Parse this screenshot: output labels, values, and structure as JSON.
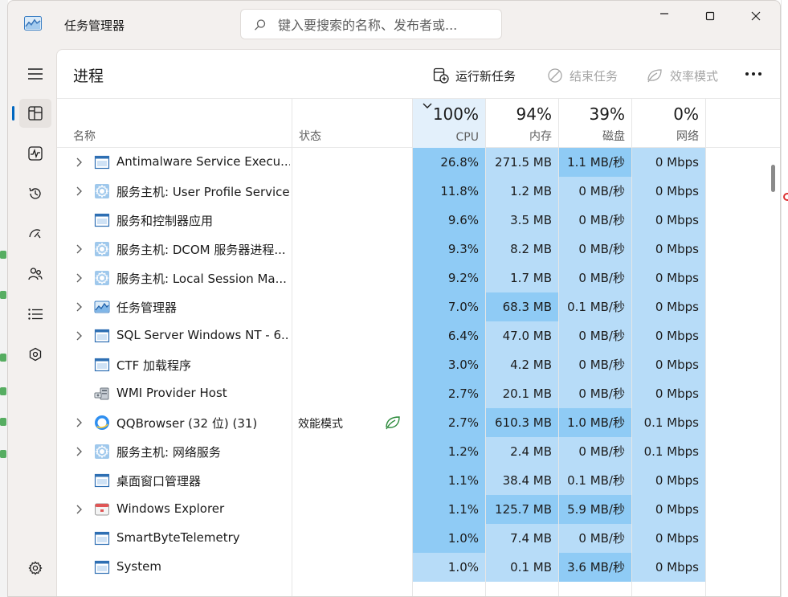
{
  "window": {
    "title": "任务管理器"
  },
  "search": {
    "placeholder": "键入要搜索的名称、发布者或..."
  },
  "page": {
    "title": "进程"
  },
  "toolbar": {
    "run_new_task": "运行新任务",
    "end_task": "结束任务",
    "efficiency_mode": "效率模式"
  },
  "columns": {
    "name": "名称",
    "status": "状态",
    "cpu": {
      "label": "CPU",
      "percent": "100%"
    },
    "memory": {
      "label": "内存",
      "percent": "94%"
    },
    "disk": {
      "label": "磁盘",
      "percent": "39%"
    },
    "network": {
      "label": "网络",
      "percent": "0%"
    }
  },
  "heat_colors": {
    "high": "#8fcbf5",
    "mid": "#b7dcf8",
    "low": "#cfe7fb"
  },
  "processes": [
    {
      "name": "Antimalware Service Execu...",
      "icon": "window-app-icon",
      "expandable": true,
      "status": "",
      "cpu": "26.8%",
      "memory": "271.5 MB",
      "disk": "1.1 MB/秒",
      "network": "0 Mbps",
      "heat": {
        "cpu": "high",
        "memory": "mid",
        "disk": "high",
        "network": "mid"
      }
    },
    {
      "name": "服务主机: User Profile Service",
      "icon": "service-gear-icon",
      "expandable": true,
      "status": "",
      "cpu": "11.8%",
      "memory": "1.2 MB",
      "disk": "0 MB/秒",
      "network": "0 Mbps",
      "heat": {
        "cpu": "high",
        "memory": "mid",
        "disk": "mid",
        "network": "mid"
      }
    },
    {
      "name": "服务和控制器应用",
      "icon": "window-app-icon",
      "expandable": false,
      "status": "",
      "cpu": "9.6%",
      "memory": "3.5 MB",
      "disk": "0 MB/秒",
      "network": "0 Mbps",
      "heat": {
        "cpu": "high",
        "memory": "mid",
        "disk": "mid",
        "network": "mid"
      }
    },
    {
      "name": "服务主机: DCOM 服务器进程...",
      "icon": "service-gear-icon",
      "expandable": true,
      "status": "",
      "cpu": "9.3%",
      "memory": "8.2 MB",
      "disk": "0 MB/秒",
      "network": "0 Mbps",
      "heat": {
        "cpu": "high",
        "memory": "mid",
        "disk": "mid",
        "network": "mid"
      }
    },
    {
      "name": "服务主机: Local Session Ma...",
      "icon": "service-gear-icon",
      "expandable": true,
      "status": "",
      "cpu": "9.2%",
      "memory": "1.7 MB",
      "disk": "0 MB/秒",
      "network": "0 Mbps",
      "heat": {
        "cpu": "high",
        "memory": "mid",
        "disk": "mid",
        "network": "mid"
      }
    },
    {
      "name": "任务管理器",
      "icon": "task-manager-icon",
      "expandable": true,
      "status": "",
      "cpu": "7.0%",
      "memory": "68.3 MB",
      "disk": "0.1 MB/秒",
      "network": "0 Mbps",
      "heat": {
        "cpu": "high",
        "memory": "high",
        "disk": "mid",
        "network": "mid"
      }
    },
    {
      "name": "SQL Server Windows NT - 6...",
      "icon": "window-app-icon",
      "expandable": true,
      "status": "",
      "cpu": "6.4%",
      "memory": "47.0 MB",
      "disk": "0 MB/秒",
      "network": "0 Mbps",
      "heat": {
        "cpu": "high",
        "memory": "mid",
        "disk": "mid",
        "network": "mid"
      }
    },
    {
      "name": "CTF 加载程序",
      "icon": "window-app-icon",
      "expandable": false,
      "status": "",
      "cpu": "3.0%",
      "memory": "4.2 MB",
      "disk": "0 MB/秒",
      "network": "0 Mbps",
      "heat": {
        "cpu": "high",
        "memory": "mid",
        "disk": "mid",
        "network": "mid"
      }
    },
    {
      "name": "WMI Provider Host",
      "icon": "wmi-provider-icon",
      "expandable": false,
      "status": "",
      "cpu": "2.7%",
      "memory": "20.1 MB",
      "disk": "0 MB/秒",
      "network": "0 Mbps",
      "heat": {
        "cpu": "high",
        "memory": "mid",
        "disk": "mid",
        "network": "mid"
      }
    },
    {
      "name": "QQBrowser (32 位) (31)",
      "icon": "qqbrowser-icon",
      "expandable": true,
      "status": "效能模式",
      "efficiency_leaf": true,
      "cpu": "2.7%",
      "memory": "610.3 MB",
      "disk": "1.0 MB/秒",
      "network": "0.1 Mbps",
      "heat": {
        "cpu": "high",
        "memory": "high",
        "disk": "high",
        "network": "mid"
      }
    },
    {
      "name": "服务主机: 网络服务",
      "icon": "service-gear-icon",
      "expandable": true,
      "status": "",
      "cpu": "1.2%",
      "memory": "2.4 MB",
      "disk": "0 MB/秒",
      "network": "0.1 Mbps",
      "heat": {
        "cpu": "high",
        "memory": "mid",
        "disk": "mid",
        "network": "mid"
      }
    },
    {
      "name": "桌面窗口管理器",
      "icon": "window-app-icon",
      "expandable": false,
      "status": "",
      "cpu": "1.1%",
      "memory": "38.4 MB",
      "disk": "0.1 MB/秒",
      "network": "0 Mbps",
      "heat": {
        "cpu": "high",
        "memory": "mid",
        "disk": "mid",
        "network": "mid"
      }
    },
    {
      "name": "Windows Explorer",
      "icon": "explorer-icon",
      "expandable": true,
      "status": "",
      "cpu": "1.1%",
      "memory": "125.7 MB",
      "disk": "5.9 MB/秒",
      "network": "0 Mbps",
      "heat": {
        "cpu": "high",
        "memory": "high",
        "disk": "high",
        "network": "mid"
      }
    },
    {
      "name": "SmartByteTelemetry",
      "icon": "window-app-icon",
      "expandable": false,
      "status": "",
      "cpu": "1.0%",
      "memory": "7.4 MB",
      "disk": "0 MB/秒",
      "network": "0 Mbps",
      "heat": {
        "cpu": "high",
        "memory": "mid",
        "disk": "mid",
        "network": "mid"
      }
    },
    {
      "name": "System",
      "icon": "window-app-icon",
      "expandable": false,
      "status": "",
      "cpu": "1.0%",
      "memory": "0.1 MB",
      "disk": "3.6 MB/秒",
      "network": "0 Mbps",
      "heat": {
        "cpu": "mid",
        "memory": "mid",
        "disk": "high",
        "network": "mid"
      }
    }
  ]
}
